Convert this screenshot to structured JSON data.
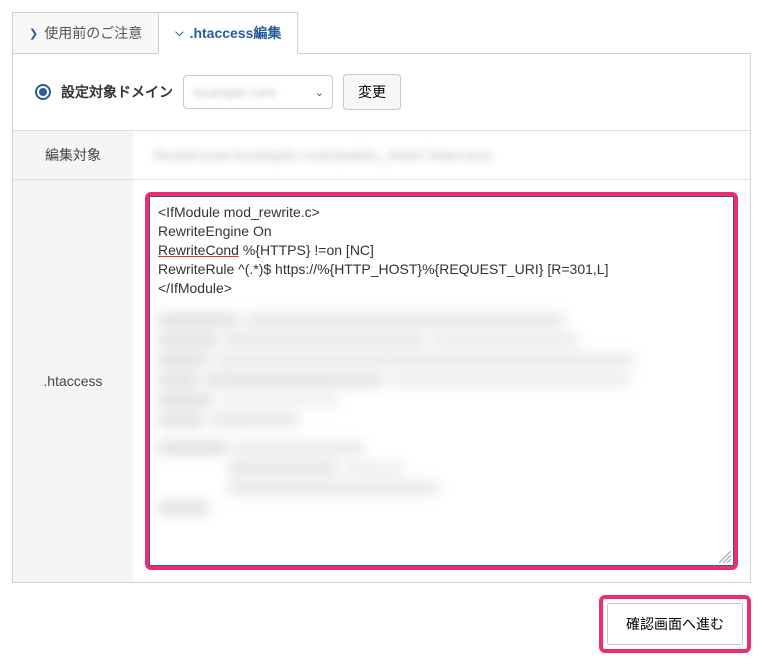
{
  "tabs": {
    "notes": {
      "label": "使用前のご注意"
    },
    "edit": {
      "label": ".htaccess編集"
    }
  },
  "domain": {
    "label": "設定対象ドメイン",
    "selected_placeholder": "example.com",
    "change_label": "変更"
  },
  "rows": {
    "edit_target": {
      "label": "編集対象",
      "value_placeholder": "/home/user/example.com/public_html/.htaccess"
    },
    "htaccess": {
      "label": ".htaccess"
    }
  },
  "textarea": {
    "lines": [
      "<IfModule mod_rewrite.c>",
      "RewriteEngine On",
      "RewriteCond %{HTTPS} !=on [NC]",
      "RewriteRule ^(.*)$ https://%{HTTP_HOST}%{REQUEST_URI} [R=301,L]",
      "</IfModule>"
    ],
    "underline_token": "RewriteCond"
  },
  "footer": {
    "confirm_label": "確認画面へ進む"
  }
}
